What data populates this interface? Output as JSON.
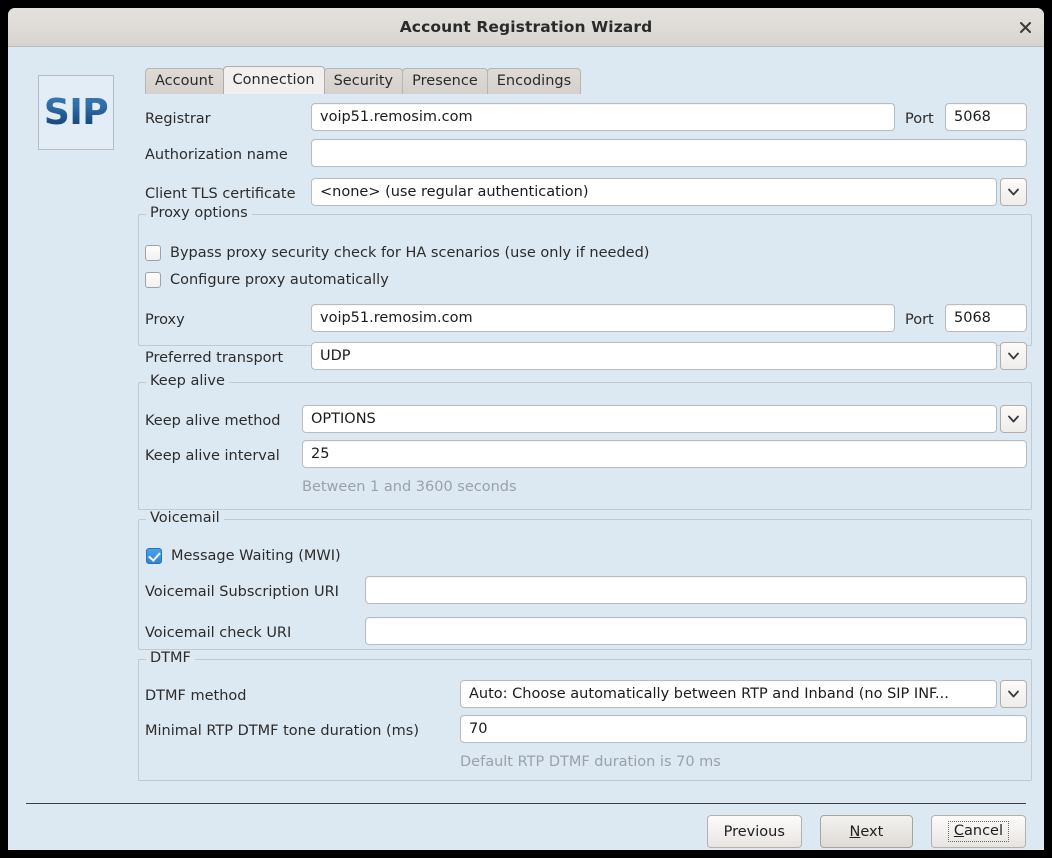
{
  "window": {
    "title": "Account Registration Wizard",
    "close_icon": "close-icon"
  },
  "logo": {
    "text": "SIP"
  },
  "tabs": [
    {
      "label": "Account",
      "active": false
    },
    {
      "label": "Connection",
      "active": true
    },
    {
      "label": "Security",
      "active": false
    },
    {
      "label": "Presence",
      "active": false
    },
    {
      "label": "Encodings",
      "active": false
    }
  ],
  "connection": {
    "registrar_label": "Registrar",
    "registrar_value": "voip51.remosim.com",
    "registrar_port_label": "Port",
    "registrar_port_value": "5068",
    "authorization_label": "Authorization name",
    "authorization_value": "",
    "tls_label": "Client TLS certificate",
    "tls_value": "<none> (use regular authentication)"
  },
  "proxy": {
    "legend": "Proxy options",
    "bypass_label": "Bypass proxy security check for HA scenarios (use only if needed)",
    "bypass_checked": false,
    "auto_label": "Configure proxy automatically",
    "auto_checked": false,
    "proxy_label": "Proxy",
    "proxy_value": "voip51.remosim.com",
    "proxy_port_label": "Port",
    "proxy_port_value": "5068",
    "transport_label": "Preferred transport",
    "transport_value": "UDP"
  },
  "keepalive": {
    "legend": "Keep alive",
    "method_label": "Keep alive method",
    "method_value": "OPTIONS",
    "interval_label": "Keep alive interval",
    "interval_value": "25",
    "interval_hint": "Between 1 and 3600 seconds"
  },
  "voicemail": {
    "legend": "Voicemail",
    "mwi_label": "Message Waiting (MWI)",
    "mwi_checked": true,
    "subscription_label": "Voicemail Subscription URI",
    "subscription_value": "",
    "check_label": "Voicemail check URI",
    "check_value": ""
  },
  "dtmf": {
    "legend": "DTMF",
    "method_label": "DTMF method",
    "method_value": "Auto: Choose automatically between RTP and Inband (no SIP INF...",
    "duration_label": "Minimal RTP DTMF tone duration (ms)",
    "duration_value": "70",
    "duration_hint": "Default RTP DTMF duration is 70 ms"
  },
  "footer": {
    "previous": "Previous",
    "next_pre": "N",
    "next_post": "ext",
    "cancel_pre": "C",
    "cancel_post": "ancel"
  },
  "colors": {
    "dialog_bg": "#dde9f2",
    "titlebar_bg": "#dedbd6",
    "accent_checkbox": "#2e86d4",
    "logo_blue": "#1d4f85",
    "hint_text": "#9aa1a8"
  }
}
